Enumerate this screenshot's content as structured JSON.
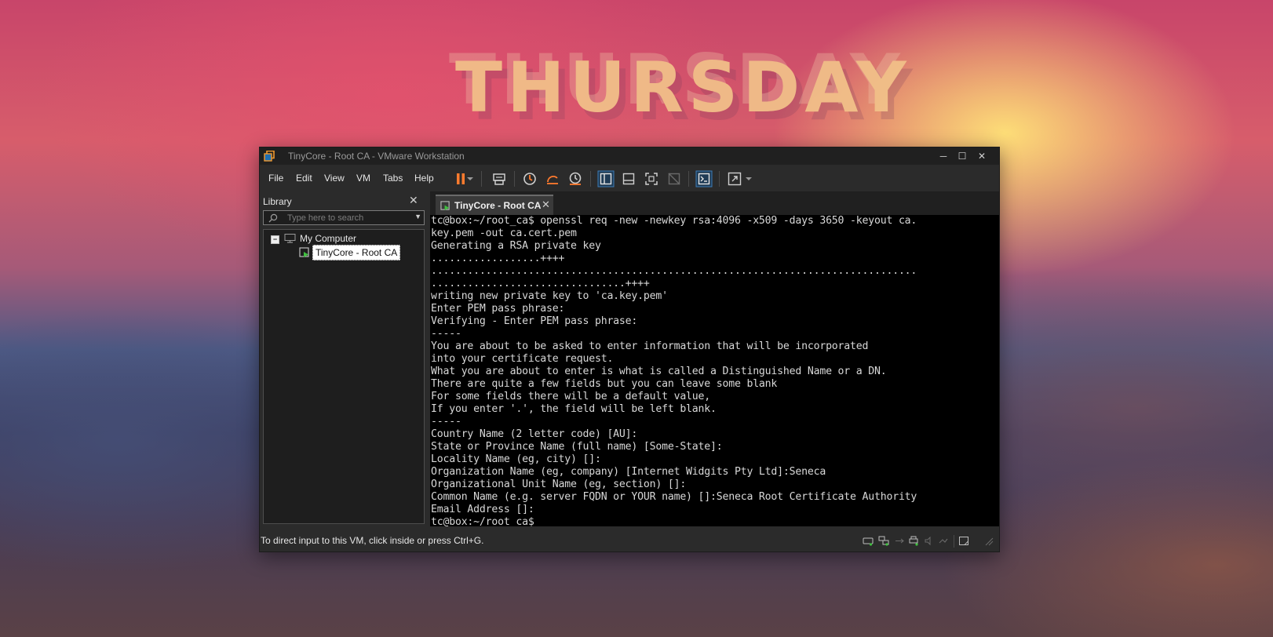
{
  "wallpaper": {
    "day_text": "THURSDAY"
  },
  "window": {
    "title": "TinyCore - Root CA - VMware Workstation",
    "controls": {
      "minimize": "─",
      "maximize": "☐",
      "close": "✕"
    }
  },
  "menu": {
    "items": [
      "File",
      "Edit",
      "View",
      "VM",
      "Tabs",
      "Help"
    ]
  },
  "toolbar": {
    "icons": [
      "pause-icon",
      "power-dropdown-icon",
      "send-ctrl-alt-del-icon",
      "snapshot-take-icon",
      "snapshot-revert-icon",
      "snapshot-manager-icon",
      "show-library-icon",
      "show-thumbnail-bar-icon",
      "full-screen-icon",
      "unity-icon",
      "console-view-icon",
      "stretch-guest-icon"
    ],
    "accent": "#ff7b2e"
  },
  "library": {
    "title": "Library",
    "close": "✕",
    "search_placeholder": "Type here to search",
    "tree": {
      "root_toggle": "−",
      "root_label": "My Computer",
      "vm_label": "TinyCore - Root CA"
    }
  },
  "vm_tab": {
    "label": "TinyCore - Root CA",
    "close": "✕"
  },
  "console": {
    "lines": [
      "tc@box:~/root_ca$ openssl req -new -newkey rsa:4096 -x509 -days 3650 -keyout ca.",
      "key.pem -out ca.cert.pem",
      "Generating a RSA private key",
      "..................++++",
      "................................................................................",
      "................................++++",
      "writing new private key to 'ca.key.pem'",
      "Enter PEM pass phrase:",
      "Verifying - Enter PEM pass phrase:",
      "-----",
      "You are about to be asked to enter information that will be incorporated",
      "into your certificate request.",
      "What you are about to enter is what is called a Distinguished Name or a DN.",
      "There are quite a few fields but you can leave some blank",
      "For some fields there will be a default value,",
      "If you enter '.', the field will be left blank.",
      "-----",
      "Country Name (2 letter code) [AU]:",
      "State or Province Name (full name) [Some-State]:",
      "Locality Name (eg, city) []:",
      "Organization Name (eg, company) [Internet Widgits Pty Ltd]:Seneca",
      "Organizational Unit Name (eg, section) []:",
      "Common Name (e.g. server FQDN or YOUR name) []:Seneca Root Certificate Authority",
      "Email Address []:",
      "tc@box:~/root_ca$"
    ]
  },
  "status_bar": {
    "text": "To direct input to this VM, click inside or press Ctrl+G.",
    "icons": [
      "hard-disk-icon",
      "network-icon",
      "usb-icon",
      "printer-icon",
      "sound-icon",
      "display-icon",
      "message-log-icon"
    ]
  }
}
